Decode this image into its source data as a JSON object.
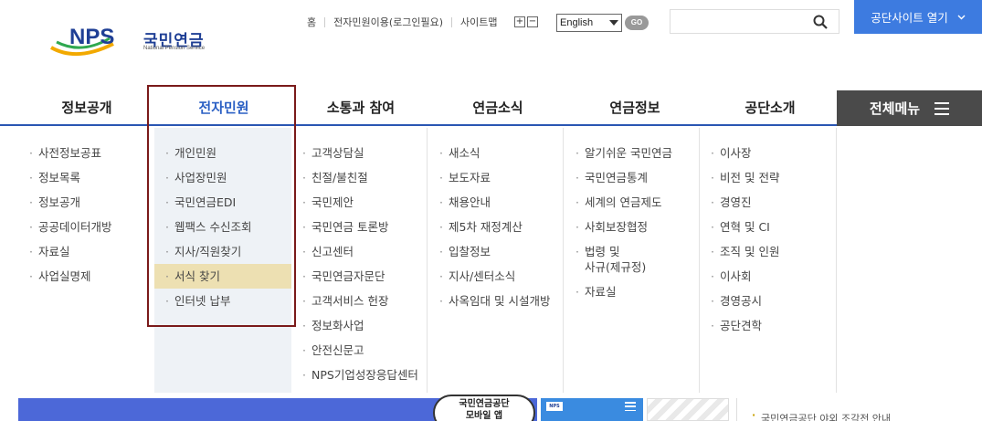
{
  "logo": {
    "text": "NPS",
    "name_kr": "국민연금",
    "name_en": "National Pension Service"
  },
  "utility": {
    "home": "홈",
    "civil_login": "전자민원이용(로그인필요)",
    "sitemap": "사이트맵",
    "zoom_in": "+",
    "zoom_out": "−"
  },
  "language": {
    "selected": "English",
    "go": "GO"
  },
  "search": {
    "placeholder": ""
  },
  "open_site": "공단사이트 열기",
  "nav": {
    "items": [
      "정보공개",
      "전자민원",
      "소통과 참여",
      "연금소식",
      "연금정보",
      "공단소개"
    ],
    "all_menu": "전체메뉴"
  },
  "menu": {
    "col1": [
      "사전정보공표",
      "정보목록",
      "정보공개",
      "공공데이터개방",
      "자료실",
      "사업실명제"
    ],
    "col2": [
      "개인민원",
      "사업장민원",
      "국민연금EDI",
      "웹팩스 수신조회",
      "지사/직원찾기",
      "서식 찾기",
      "인터넷 납부"
    ],
    "col3": [
      "고객상담실",
      "친절/불친절",
      "국민제안",
      "국민연금 토론방",
      "신고센터",
      "국민연금자문단",
      "고객서비스 헌장",
      "정보화사업",
      "안전신문고",
      "NPS기업성장응답센터"
    ],
    "col4": [
      "새소식",
      "보도자료",
      "채용안내",
      "제5차 재정계산",
      "입찰정보",
      "지사/센터소식",
      "사옥임대 및 시설개방"
    ],
    "col5": [
      "알기쉬운 국민연금",
      "국민연금통계",
      "세계의 연금제도",
      "사회보장협정",
      "법령 및\n사규(제규정)",
      "자료실"
    ],
    "col6": [
      "이사장",
      "비전 및 전략",
      "경영진",
      "연혁 및 CI",
      "조직 및 인원",
      "이사회",
      "경영공시",
      "공단견학"
    ]
  },
  "highlight_index": 5,
  "banner": {
    "app_line1": "국민연금공단",
    "app_line2": "모바일 앱",
    "mini_logo": "NPS"
  },
  "notice": "국민연금공단 야외 조각전 안내",
  "colors": {
    "accent": "#2a5fc4",
    "button": "#3d7be0",
    "highlight": "#ede0b2",
    "box": "#7a1a1a"
  }
}
